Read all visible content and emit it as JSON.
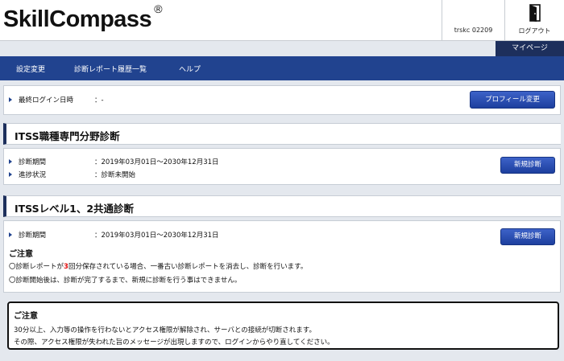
{
  "header": {
    "logo_text": "SkillCompass",
    "logo_mark": "®",
    "user_id": "trskc 02209",
    "logout_label": "ログアウト",
    "logout_icon": "door-exit-icon"
  },
  "mypage_tab": "マイページ",
  "nav": {
    "items": [
      {
        "label": "設定変更"
      },
      {
        "label": "診断レポート履歴一覧"
      },
      {
        "label": "ヘルプ"
      }
    ]
  },
  "login": {
    "label": "最終ログイン日時",
    "value": "：-",
    "profile_button": "プロフィール変更"
  },
  "itss_specialty": {
    "title": "ITSS職種専門分野診断",
    "period_label": "診断期間",
    "period_value": "：2019年03月01日～2030年12月31日",
    "status_label": "進捗状況",
    "status_value": "：診断未開始",
    "new_button": "新規診断"
  },
  "itss_common": {
    "title": "ITSSレベル1、2共通診断",
    "period_label": "診断期間",
    "period_value": "：2019年03月01日～2030年12月31日",
    "new_button": "新規診断",
    "notice_title": "ご注意",
    "notice_line1_pre": "〇診断レポートが",
    "notice_line1_num": "3",
    "notice_line1_post": "回分保存されている場合、一番古い診断レポートを消去し、診断を行います。",
    "notice_line2": "〇診断開始後は、診断が完了するまで、新規に診断を行う事はできません。"
  },
  "caution": {
    "title": "ご注意",
    "line1": "30分以上、入力等の操作を行わないとアクセス権限が解除され、サーバとの接続が切断されます。",
    "line2": "その際、アクセス権限が失われた旨のメッセージが出現しますので、ログインからやり直してください。"
  },
  "colors": {
    "nav": "#21438f",
    "accent_dark": "#1d2f5c",
    "button": "#2a4fb5",
    "highlight": "#e01010"
  }
}
